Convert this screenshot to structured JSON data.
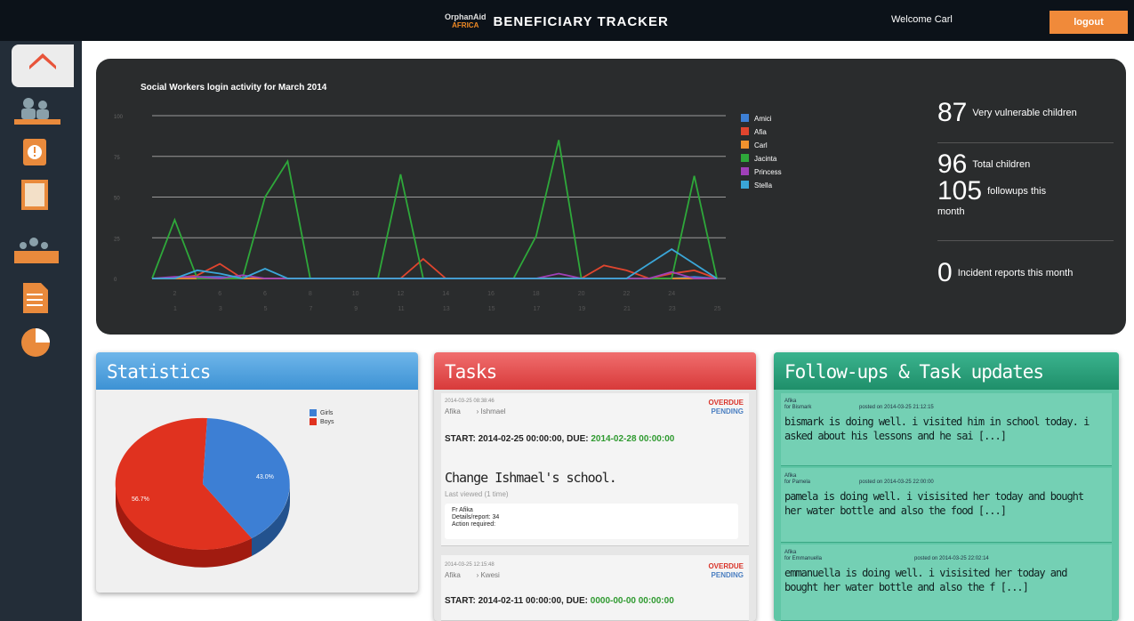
{
  "header": {
    "logo_line1": "OrphanAid",
    "logo_line2": "AFRICA",
    "title": "BENEFICIARY TRACKER",
    "welcome": "Welcome Carl",
    "logout_label": "logout"
  },
  "sidebar": {
    "items": [
      {
        "icon": "home-icon"
      },
      {
        "icon": "people-icon"
      },
      {
        "icon": "alert-icon"
      },
      {
        "icon": "document-icon"
      },
      {
        "icon": "group-icon"
      },
      {
        "icon": "report-icon"
      },
      {
        "icon": "pie-chart-icon"
      }
    ]
  },
  "chart_data": {
    "type": "line",
    "title": "Social Workers login activity for March 2014",
    "x": [
      1,
      2,
      3,
      4,
      5,
      6,
      7,
      8,
      9,
      10,
      11,
      12,
      13,
      14,
      15,
      16,
      17,
      18,
      19,
      20,
      21,
      22,
      23,
      24,
      25,
      26
    ],
    "xticks_top": [
      "2",
      "6",
      "6",
      "8",
      "10",
      "12",
      "14",
      "16",
      "18",
      "20",
      "22",
      "24"
    ],
    "xticks_bottom": [
      "1",
      "3",
      "5",
      "7",
      "9",
      "11",
      "13",
      "15",
      "17",
      "19",
      "21",
      "23",
      "25"
    ],
    "yticks": [
      "100",
      "75",
      "50",
      "25",
      "0"
    ],
    "ylim": [
      0,
      100
    ],
    "series": [
      {
        "name": "Amici",
        "color": "#3d7fd4",
        "values": [
          0,
          0,
          1,
          1,
          0,
          0,
          0,
          0,
          0,
          0,
          0,
          0,
          0,
          0,
          0,
          0,
          0,
          0,
          0,
          0,
          0,
          0,
          0,
          0,
          1,
          0
        ]
      },
      {
        "name": "Afia",
        "color": "#e0452e",
        "values": [
          0,
          0,
          2,
          9,
          0,
          0,
          0,
          0,
          0,
          0,
          0,
          0,
          12,
          0,
          0,
          0,
          0,
          0,
          0,
          0,
          8,
          5,
          0,
          3,
          5,
          0
        ]
      },
      {
        "name": "Carl",
        "color": "#f0922e",
        "values": [
          0,
          0,
          0,
          0,
          0,
          0,
          0,
          0,
          0,
          0,
          0,
          0,
          0,
          0,
          0,
          0,
          0,
          0,
          0,
          0,
          0,
          0,
          0,
          0,
          0,
          0
        ]
      },
      {
        "name": "Jacinta",
        "color": "#2ea83a",
        "values": [
          0,
          36,
          0,
          0,
          0,
          50,
          72,
          0,
          0,
          0,
          0,
          64,
          0,
          0,
          0,
          0,
          0,
          26,
          85,
          0,
          0,
          0,
          0,
          0,
          63,
          0
        ]
      },
      {
        "name": "Princess",
        "color": "#a040b8",
        "values": [
          0,
          1,
          1,
          0,
          2,
          0,
          0,
          0,
          0,
          0,
          0,
          0,
          0,
          0,
          0,
          0,
          0,
          0,
          3,
          0,
          0,
          0,
          0,
          4,
          0,
          0
        ]
      },
      {
        "name": "Stella",
        "color": "#3aa6d8",
        "values": [
          0,
          0,
          5,
          3,
          0,
          6,
          0,
          0,
          0,
          0,
          0,
          0,
          0,
          0,
          0,
          0,
          0,
          0,
          0,
          0,
          0,
          0,
          9,
          18,
          9,
          0
        ]
      }
    ]
  },
  "stats": {
    "s1_num": "87",
    "s1_label": "Very vulnerable children",
    "s2_num": "96",
    "s2_label": "Total children",
    "s3_num": "105",
    "s3_label_a": "followups this",
    "s3_label_b": "month",
    "s4_num": "0",
    "s4_label": "Incident reports this month"
  },
  "statistics": {
    "title": "Statistics",
    "legend": [
      {
        "name": "Girls",
        "color": "#3d7fd4"
      },
      {
        "name": "Boys",
        "color": "#e0321f"
      }
    ],
    "pie": [
      {
        "name": "Girls",
        "value": 43.0,
        "label": "43.0%",
        "color": "#3d7fd4"
      },
      {
        "name": "Boys",
        "value": 56.7,
        "label": "56.7%",
        "color": "#e0321f"
      }
    ]
  },
  "tasks": {
    "title": "Tasks",
    "items": [
      {
        "meta": "2014-03-25 08:38:46",
        "who_from": "Afika",
        "who_to": "Ishmael",
        "status1": "OVERDUE",
        "status2": "PENDING",
        "start_label": "START:",
        "start": "2014-02-25 00:00:00,",
        "due_label": "DUE:",
        "due": "2014-02-28 00:00:00",
        "name": "Change Ishmael's school.",
        "last": "Last viewed (1 time)",
        "box1": "Fr Afika",
        "box2": "Details/report: 34",
        "box3": "Action required:"
      },
      {
        "meta": "2014-03-25 12:15:48",
        "who_from": "Afika",
        "who_to": "Kwesi",
        "status1": "OVERDUE",
        "status2": "PENDING",
        "start_label": "START:",
        "start": "2014-02-11 00:00:00,",
        "due_label": "DUE:",
        "due": "0000-00-00 00:00:00"
      }
    ]
  },
  "followups": {
    "title": "Follow-ups & Task updates",
    "items": [
      {
        "who": "Afika",
        "about": "for Bismark",
        "posted": "posted on 2014-03-25 21:12:15",
        "text": "bismark is doing well. i visited him in school today. i asked about his lessons and he sai [...]"
      },
      {
        "who": "Afika",
        "about": "for Pamela",
        "posted": "posted on 2014-03-25 22:00:00",
        "text": "pamela is doing well. i visisited her today and bought her water bottle and also the food [...]"
      },
      {
        "who": "Afika",
        "about": "for Emmanuella",
        "posted": "posted on 2014-03-25 22:02:14",
        "text": "emmanuella is doing well. i visisited her today and bought her water bottle and also the f [...]"
      }
    ]
  }
}
